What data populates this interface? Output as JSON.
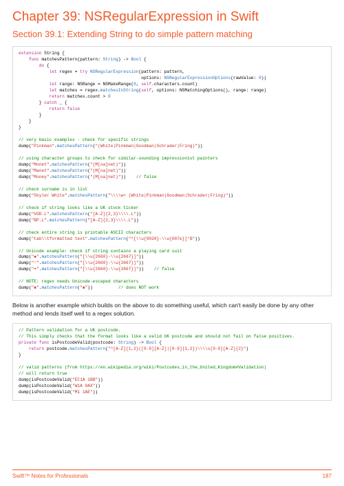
{
  "chapter_title": "Chapter 39: NSRegularExpression in Swift",
  "section_title": "Section 39.1: Extending String to do simple pattern matching",
  "body_text": "Below is another example which builds on the above to do something useful, which can't easily be done by any other method and lends itself well to a regex solution.",
  "footer_left": "Swift™ Notes for Professionals",
  "footer_right": "187",
  "code1": {
    "l01a": "extension",
    "l01b": " String {",
    "l02a": "    func",
    "l02b": " matchesPattern(pattern: ",
    "l02c": "String",
    "l02d": ") -> ",
    "l02e": "Bool",
    "l02f": " {",
    "l03a": "        do",
    "l03b": " {",
    "l04a": "            let",
    "l04b": " regex = ",
    "l04c": "try",
    "l04d": " ",
    "l04e": "NSRegularExpression",
    "l04f": "(pattern: pattern,",
    "l05a": "                                                options: ",
    "l05b": "NSRegularExpressionOptions",
    "l05c": "(rawValue: ",
    "l05d": "0",
    "l05e": "))",
    "l06a": "            let",
    "l06b": " range: NSRange = NSMakeRange(",
    "l06c": "0",
    "l06d": ", ",
    "l06e": "self",
    "l06f": ".characters.count)",
    "l07a": "            let",
    "l07b": " matches = regex.",
    "l07c": "matchesInString",
    "l07d": "(",
    "l07e": "self",
    "l07f": ", options: NSMatchingOptions(), range: range)",
    "l08a": "            return",
    "l08b": " matches.count > ",
    "l08c": "0",
    "l09a": "        } ",
    "l09b": "catch",
    "l09c": " _ {",
    "l10a": "            return",
    "l10b": " ",
    "l10c": "false",
    "l11": "        }",
    "l12": "    }",
    "l13": "}",
    "c1": "// very basic examples - check for specific strings",
    "l14a": "dump(",
    "l14b": "\"Pinkman\"",
    "l14c": ".",
    "l14d": "matchesPattern",
    "l14e": "(",
    "l14f": "\"(White|Pinkman|Goodman|Schrader|Fring)\"",
    "l14g": "))",
    "c2": "// using character groups to check for similar-sounding impressionist painters",
    "l15a": "dump(",
    "l15b": "\"Monet\"",
    "l15c": ".",
    "l15d": "matchesPattern",
    "l15e": "(",
    "l15f": "\"(M[oa]net)\"",
    "l15g": "))",
    "l16a": "dump(",
    "l16b": "\"Manet\"",
    "l16c": ".",
    "l16d": "matchesPattern",
    "l16e": "(",
    "l16f": "\"(M[oa]net)\"",
    "l16g": "))",
    "l17a": "dump(",
    "l17b": "\"Money\"",
    "l17c": ".",
    "l17d": "matchesPattern",
    "l17e": "(",
    "l17f": "\"(M[oa]net)\"",
    "l17g": "))",
    "l17h": "    // false",
    "c3": "// check surname is in list",
    "l18a": "dump(",
    "l18b": "\"Skyler White\"",
    "l18c": ".",
    "l18d": "matchesPattern",
    "l18e": "(",
    "l18f": "\"\\\\\\\\w+ (White|Pinkman|Goodman|Schrader|Fring)\"",
    "l18g": "))",
    "c4": "// check if string looks like a UK stock ticker",
    "l19a": "dump(",
    "l19b": "\"VOD.L\"",
    "l19c": ".",
    "l19d": "matchesPattern",
    "l19e": "(",
    "l19f": "\"[A-Z]{2,3}\\\\\\\\.L\"",
    "l19g": "))",
    "l20a": "dump(",
    "l20b": "\"BP.L\"",
    "l20c": ".",
    "l20d": "matchesPattern",
    "l20e": "(",
    "l20f": "\"[A-Z]{2,3}\\\\\\\\.L\"",
    "l20g": "))",
    "c5": "// check entire string is printable ASCII characters",
    "l21a": "dump(",
    "l21b": "\"tab\\\\tformatted text\"",
    "l21c": ".",
    "l21d": "matchesPattern",
    "l21e": "(",
    "l21f": "\"^[\\\\u{0020}-\\\\u{007e}]*$\"",
    "l21g": "))",
    "c6": "// Unicode example: check if string contains a playing card suit",
    "l22a": "dump(",
    "l22b": "\"♠︎\"",
    "l22c": ".",
    "l22d": "matchesPattern",
    "l22e": "(",
    "l22f": "\"[\\\\u{2660}-\\\\u{2667}]\"",
    "l22g": "))",
    "l23a": "dump(",
    "l23b": "\"♡\"",
    "l23c": ".",
    "l23d": "matchesPattern",
    "l23e": "(",
    "l23f": "\"[\\\\u{2660}-\\\\u{2667}]\"",
    "l23g": "))",
    "l24a": "dump(",
    "l24b": "\"☂\"",
    "l24c": ".",
    "l24d": "matchesPattern",
    "l24e": "(",
    "l24f": "\"[\\\\u{2660}-\\\\u{2667}]\"",
    "l24g": "))",
    "l24h": "    // false",
    "c7": "// NOTE: regex needs Unicode-escaped characters",
    "l25a": "dump(",
    "l25b": "\"♣︎\"",
    "l25c": ".",
    "l25d": "matchesPattern",
    "l25e": "(",
    "l25f": "\"♣︎\"",
    "l25g": "))",
    "l25h": "          // does NOT work"
  },
  "code2": {
    "c1a": "// Pattern validation for a UK postcode.",
    "c1b": "// This simply checks that the format looks like a valid UK postcode and should not fail on false positives.",
    "l1a": "private",
    "l1b": " ",
    "l1c": "func",
    "l1d": " isPostcodeValid(postcode: ",
    "l1e": "String",
    "l1f": ") -> ",
    "l1g": "Bool",
    "l1h": " {",
    "l2a": "    return",
    "l2b": " postcode.",
    "l2c": "matchesPattern",
    "l2d": "(",
    "l2e": "\"^[A-Z]{1,2}([0-9][A-Z]|[0-9]{1,2})\\\\\\\\s[0-9][A-Z]{2}\"",
    "l2f": ")",
    "l3": "}",
    "c2a": "// valid patterns (from https://en.wikipedia.org/wiki/Postcodes_in_the_United_Kingdom#Validation)",
    "c2b": "// will return true",
    "l4a": "dump(isPostcodeValid(",
    "l4b": "\"EC1A 1BB\"",
    "l4c": "))",
    "l5a": "dump(isPostcodeValid(",
    "l5b": "\"W1A 0AX\"",
    "l5c": "))",
    "l6a": "dump(isPostcodeValid(",
    "l6b": "\"M1 1AE\"",
    "l6c": "))"
  }
}
